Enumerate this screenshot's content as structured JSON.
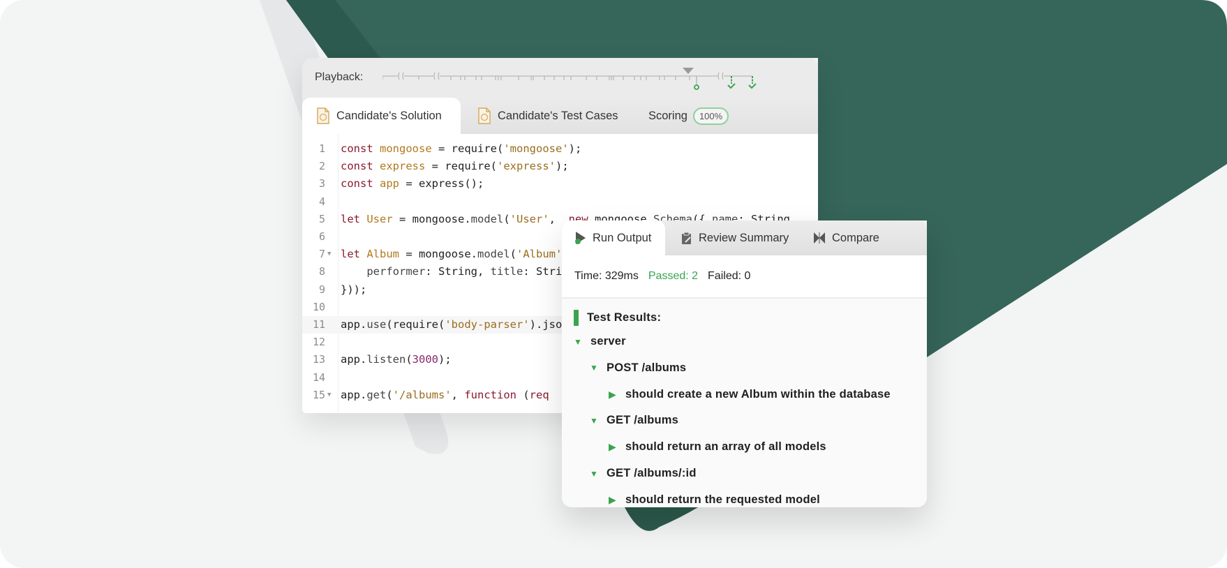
{
  "colors": {
    "accent_green": "#3ba34f",
    "brand_dark_green": "#36655a",
    "background": "#f3f4f4"
  },
  "playback": {
    "label": "Playback:",
    "markers": [
      "run-circle",
      "pass-check",
      "pass-check"
    ]
  },
  "editor_tabs": [
    {
      "label": "Candidate's Solution",
      "icon": "js-file-icon",
      "active": true
    },
    {
      "label": "Candidate's Test Cases",
      "icon": "js-file-icon",
      "active": false
    },
    {
      "label": "Scoring",
      "badge": "100%",
      "active": false
    }
  ],
  "code": {
    "lines": [
      {
        "n": "1",
        "fold": false,
        "tokens": [
          [
            "kw",
            "const"
          ],
          [
            "plain",
            " "
          ],
          [
            "var",
            "mongoose"
          ],
          [
            "plain",
            " = require("
          ],
          [
            "str",
            "'mongoose'"
          ],
          [
            "plain",
            ");"
          ]
        ]
      },
      {
        "n": "2",
        "fold": false,
        "tokens": [
          [
            "kw",
            "const"
          ],
          [
            "plain",
            " "
          ],
          [
            "var",
            "express"
          ],
          [
            "plain",
            " = require("
          ],
          [
            "str",
            "'express'"
          ],
          [
            "plain",
            ");"
          ]
        ]
      },
      {
        "n": "3",
        "fold": false,
        "tokens": [
          [
            "kw",
            "const"
          ],
          [
            "plain",
            " "
          ],
          [
            "var",
            "app"
          ],
          [
            "plain",
            " = express();"
          ]
        ]
      },
      {
        "n": "4",
        "fold": false,
        "tokens": []
      },
      {
        "n": "5",
        "fold": false,
        "tokens": [
          [
            "kw",
            "let"
          ],
          [
            "plain",
            " "
          ],
          [
            "var",
            "User"
          ],
          [
            "plain",
            " = mongoose."
          ],
          [
            "fn",
            "model"
          ],
          [
            "plain",
            "("
          ],
          [
            "str",
            "'User'"
          ],
          [
            "plain",
            ",  "
          ],
          [
            "kw",
            "new"
          ],
          [
            "plain",
            " mongoose."
          ],
          [
            "fn",
            "Schema"
          ],
          [
            "plain",
            "({ "
          ],
          [
            "fn",
            "name"
          ],
          [
            "plain",
            ": String"
          ]
        ]
      },
      {
        "n": "6",
        "fold": false,
        "tokens": []
      },
      {
        "n": "7",
        "fold": true,
        "tokens": [
          [
            "kw",
            "let"
          ],
          [
            "plain",
            " "
          ],
          [
            "var",
            "Album"
          ],
          [
            "plain",
            " = mongoose."
          ],
          [
            "fn",
            "model"
          ],
          [
            "plain",
            "("
          ],
          [
            "str",
            "'Album'"
          ]
        ]
      },
      {
        "n": "8",
        "fold": false,
        "tokens": [
          [
            "plain",
            "    "
          ],
          [
            "fn",
            "performer"
          ],
          [
            "plain",
            ": String, "
          ],
          [
            "fn",
            "title"
          ],
          [
            "plain",
            ": String"
          ]
        ]
      },
      {
        "n": "9",
        "fold": false,
        "tokens": [
          [
            "plain",
            "}));"
          ]
        ]
      },
      {
        "n": "10",
        "fold": false,
        "tokens": []
      },
      {
        "n": "11",
        "fold": false,
        "highlight": true,
        "tokens": [
          [
            "plain",
            "app."
          ],
          [
            "fn",
            "use"
          ],
          [
            "plain",
            "(require("
          ],
          [
            "str",
            "'body-parser'"
          ],
          [
            "plain",
            ").json"
          ]
        ]
      },
      {
        "n": "12",
        "fold": false,
        "tokens": []
      },
      {
        "n": "13",
        "fold": false,
        "tokens": [
          [
            "plain",
            "app."
          ],
          [
            "fn",
            "listen"
          ],
          [
            "plain",
            "("
          ],
          [
            "num",
            "3000"
          ],
          [
            "plain",
            ");"
          ]
        ]
      },
      {
        "n": "14",
        "fold": false,
        "tokens": []
      },
      {
        "n": "15",
        "fold": true,
        "tokens": [
          [
            "plain",
            "app."
          ],
          [
            "fn",
            "get"
          ],
          [
            "plain",
            "("
          ],
          [
            "str",
            "'/albums'"
          ],
          [
            "plain",
            ", "
          ],
          [
            "kw",
            "function"
          ],
          [
            "plain",
            " ("
          ],
          [
            "kw",
            "req"
          ]
        ]
      }
    ]
  },
  "results": {
    "tabs": [
      {
        "label": "Run Output",
        "icon": "run-icon",
        "active": true
      },
      {
        "label": "Review Summary",
        "icon": "clipboard-icon",
        "active": false
      },
      {
        "label": "Compare",
        "icon": "compare-icon",
        "active": false
      }
    ],
    "stats": {
      "time": "Time: 329ms",
      "passed": "Passed: 2",
      "failed": "Failed: 0"
    },
    "title": "Test Results:",
    "tree": [
      {
        "level": 0,
        "type": "group",
        "label": "server"
      },
      {
        "level": 1,
        "type": "group",
        "label": "POST /albums"
      },
      {
        "level": 2,
        "type": "test",
        "label": "should create a new Album within the database"
      },
      {
        "level": 1,
        "type": "group",
        "label": "GET /albums"
      },
      {
        "level": 2,
        "type": "test",
        "label": "should return an array of all models"
      },
      {
        "level": 1,
        "type": "group",
        "label": "GET /albums/:id"
      },
      {
        "level": 2,
        "type": "test",
        "label": "should return the requested model"
      }
    ]
  }
}
